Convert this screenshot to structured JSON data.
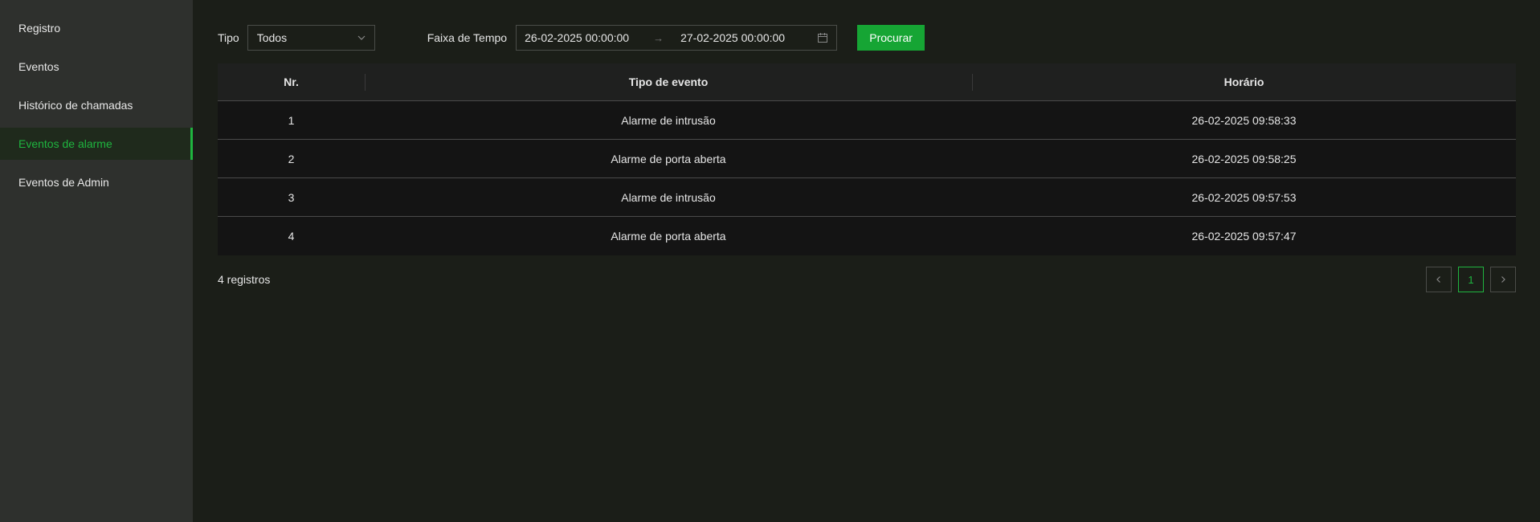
{
  "sidebar": {
    "items": [
      {
        "label": "Registro"
      },
      {
        "label": "Eventos"
      },
      {
        "label": "Histórico de chamadas"
      },
      {
        "label": "Eventos de alarme"
      },
      {
        "label": "Eventos de Admin"
      }
    ]
  },
  "filters": {
    "type_label": "Tipo",
    "type_value": "Todos",
    "range_label": "Faixa de Tempo",
    "start": "26-02-2025 00:00:00",
    "end": "27-02-2025 00:00:00",
    "search_label": "Procurar"
  },
  "table": {
    "headers": [
      "Nr.",
      "Tipo de evento",
      "Horário"
    ],
    "rows": [
      [
        "1",
        "Alarme de intrusão",
        "26-02-2025 09:58:33"
      ],
      [
        "2",
        "Alarme de porta aberta",
        "26-02-2025 09:58:25"
      ],
      [
        "3",
        "Alarme de intrusão",
        "26-02-2025 09:57:53"
      ],
      [
        "4",
        "Alarme de porta aberta",
        "26-02-2025 09:57:47"
      ]
    ]
  },
  "footer": {
    "count": "4 registros",
    "page": "1"
  },
  "colors": {
    "accent": "#16a534",
    "sidebar_bg": "#2e302d",
    "main_bg": "#1b1e18"
  }
}
